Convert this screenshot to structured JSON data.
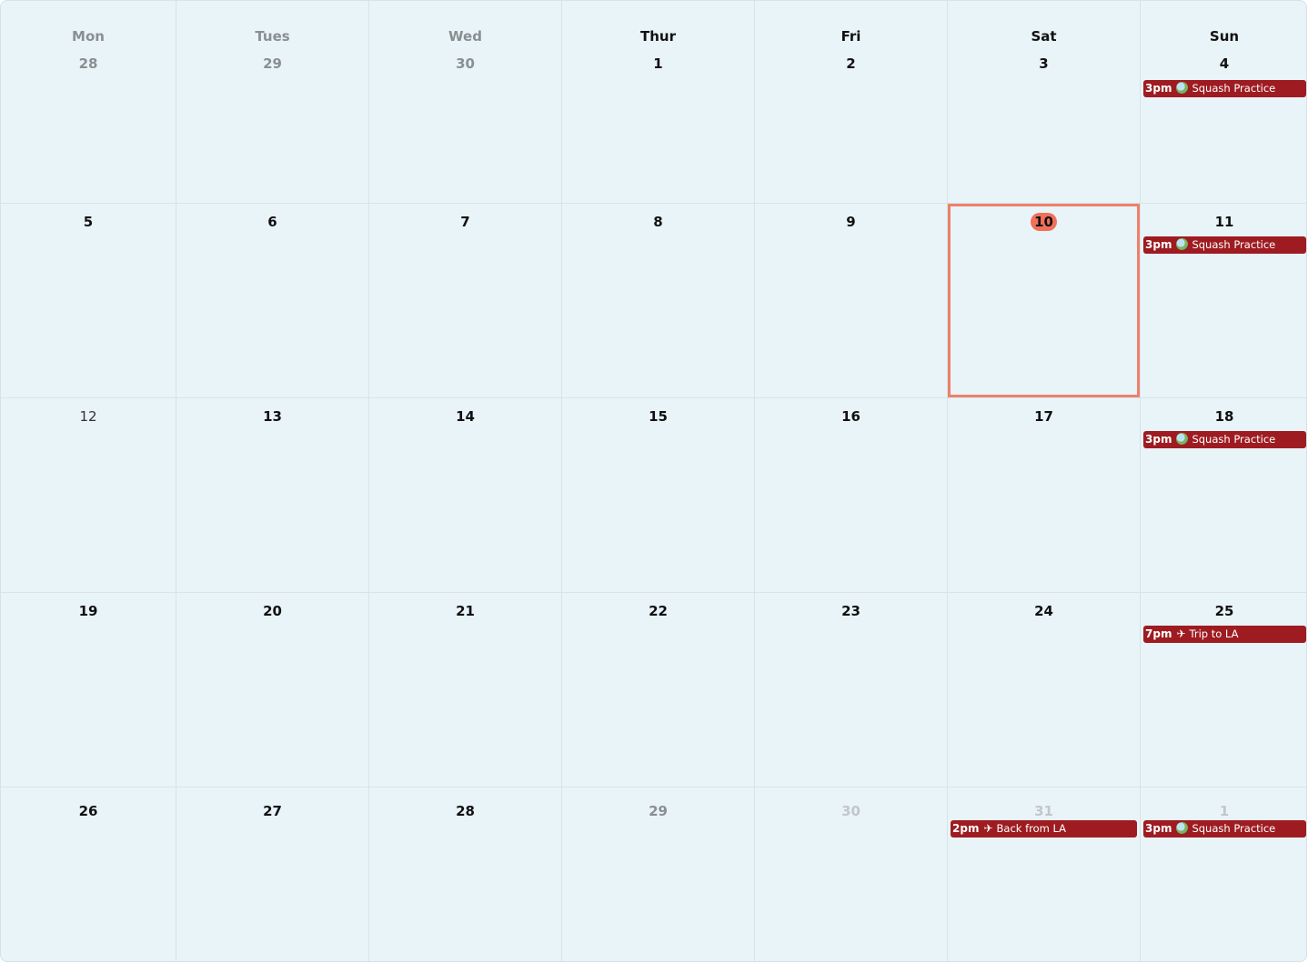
{
  "weekdays": [
    "Mon",
    "Tues",
    "Wed",
    "Thur",
    "Fri",
    "Sat",
    "Sun"
  ],
  "weeks": [
    [
      "28",
      "29",
      "30",
      "1",
      "2",
      "3",
      "4"
    ],
    [
      "5",
      "6",
      "7",
      "8",
      "9",
      "10",
      "11"
    ],
    [
      "12",
      "13",
      "14",
      "15",
      "16",
      "17",
      "18"
    ],
    [
      "19",
      "20",
      "21",
      "22",
      "23",
      "24",
      "25"
    ],
    [
      "26",
      "27",
      "28",
      "29",
      "30",
      "31",
      "1"
    ]
  ],
  "today": "10",
  "colors": {
    "background": "#e9f4f9",
    "event": "#9e1c21",
    "today": "#f0705a",
    "selection": "#ee806a"
  },
  "events": [
    {
      "week": 0,
      "day": 6,
      "time": "3pm",
      "icon": "sports-ball-icon",
      "title": "Squash Practice"
    },
    {
      "week": 1,
      "day": 6,
      "time": "3pm",
      "icon": "sports-ball-icon",
      "title": "Squash Practice"
    },
    {
      "week": 2,
      "day": 6,
      "time": "3pm",
      "icon": "sports-ball-icon",
      "title": "Squash Practice"
    },
    {
      "week": 3,
      "day": 6,
      "time": "7pm",
      "icon": "airplane-icon",
      "title": "Trip to LA"
    },
    {
      "week": 4,
      "day": 5,
      "time": "2pm",
      "icon": "airplane-icon",
      "title": "Back from LA"
    },
    {
      "week": 4,
      "day": 6,
      "time": "3pm",
      "icon": "sports-ball-icon",
      "title": "Squash Practice"
    }
  ]
}
